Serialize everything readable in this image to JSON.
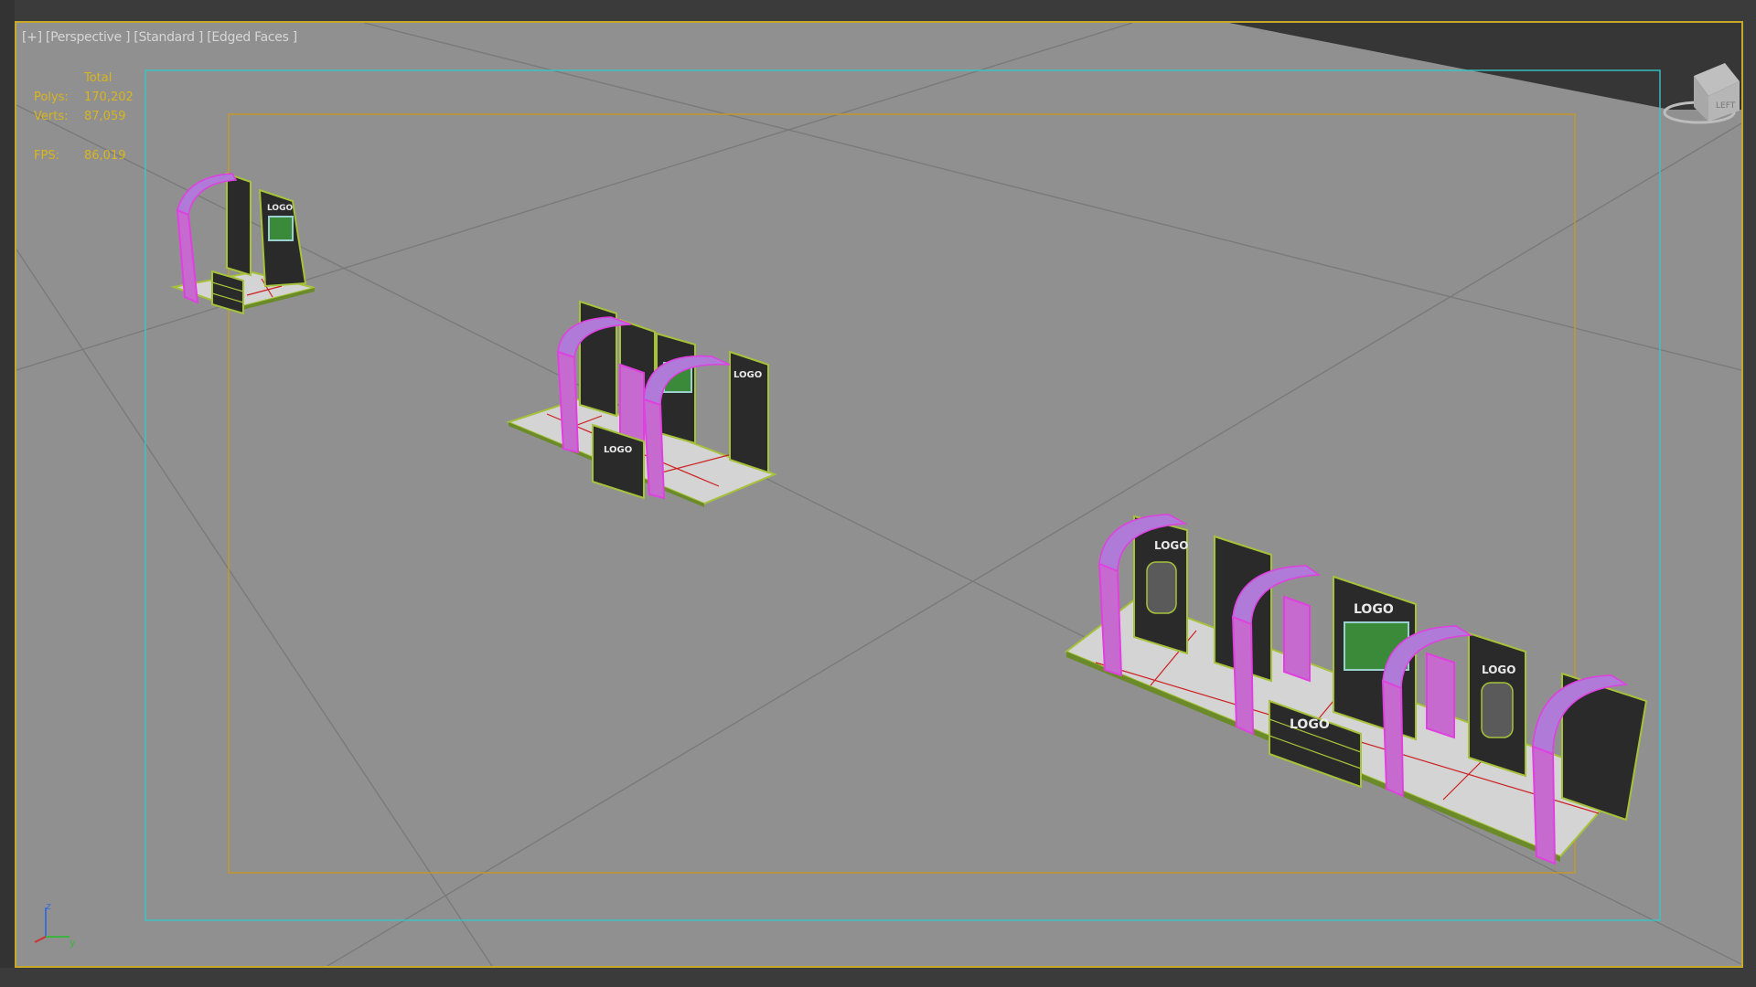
{
  "viewport": {
    "label": "[+] [Perspective ] [Standard ] [Edged Faces ]",
    "background": "#909090",
    "border_color": "#c7a82a"
  },
  "stats": {
    "header": "Total",
    "polys_label": "Polys:",
    "polys_value": "170,202",
    "verts_label": "Verts:",
    "verts_value": "87,059",
    "fps_label": "FPS:",
    "fps_value": "86,019",
    "text_color": "#d8b51e"
  },
  "axis_gizmo": {
    "z_label": "z",
    "y_label": "y"
  },
  "viewcube": {
    "face_label": "LEFT",
    "icon": "viewcube-icon"
  },
  "booth_logo_text": "LOGO",
  "colors": {
    "safe_frame_outer": "#35c6c6",
    "safe_frame_inner": "#c79a24",
    "arch": "#b07ad8",
    "arch_edge": "#e040e0",
    "panel": "#2a2a2a",
    "panel_edge": "#a5c23a",
    "floor": "#d8d8d8",
    "floor_grid": "#cc2020"
  }
}
